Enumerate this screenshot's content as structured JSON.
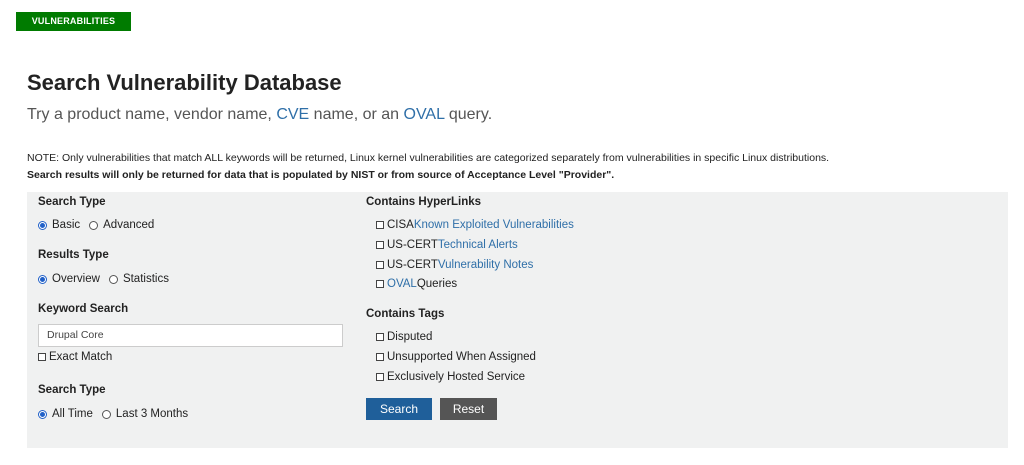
{
  "badge": "VULNERABILITIES",
  "title": "Search Vulnerability Database",
  "subtitle": {
    "pre": "Try a product name, vendor name, ",
    "cve": "CVE",
    "mid": " name, or an ",
    "oval": "OVAL",
    "post": " query."
  },
  "note": {
    "line1": "NOTE: Only vulnerabilities that match ALL keywords will be returned, Linux kernel vulnerabilities are categorized separately from vulnerabilities in specific Linux distributions.",
    "line2": "Search results will only be returned for data that is populated by NIST or from source of Acceptance Level \"Provider\"."
  },
  "form": {
    "search_type": {
      "label": "Search Type",
      "options": [
        "Basic",
        "Advanced"
      ],
      "selected": "Basic"
    },
    "results_type": {
      "label": "Results Type",
      "options": [
        "Overview",
        "Statistics"
      ],
      "selected": "Overview"
    },
    "keyword": {
      "label": "Keyword Search",
      "value": "Drupal Core",
      "exact_match_label": "Exact Match"
    },
    "time_type": {
      "label": "Search Type",
      "options": [
        "All Time",
        "Last 3 Months"
      ],
      "selected": "All Time"
    },
    "hyperlinks": {
      "label": "Contains HyperLinks",
      "items": [
        {
          "prefix": "CISA ",
          "link": "Known Exploited Vulnerabilities",
          "suffix": ""
        },
        {
          "prefix": "US-CERT ",
          "link": "Technical Alerts",
          "suffix": ""
        },
        {
          "prefix": "US-CERT ",
          "link": "Vulnerability Notes",
          "suffix": ""
        },
        {
          "prefix": "",
          "link": "OVAL",
          "suffix": " Queries"
        }
      ]
    },
    "tags": {
      "label": "Contains Tags",
      "items": [
        "Disputed",
        "Unsupported When Assigned",
        "Exclusively Hosted Service"
      ]
    },
    "search_button": "Search",
    "reset_button": "Reset"
  },
  "colors": {
    "badge": "#007b00",
    "link": "#2f6fa8",
    "search_button": "#1f5f9a",
    "reset_button": "#555555",
    "panel": "#f0f1f1"
  }
}
